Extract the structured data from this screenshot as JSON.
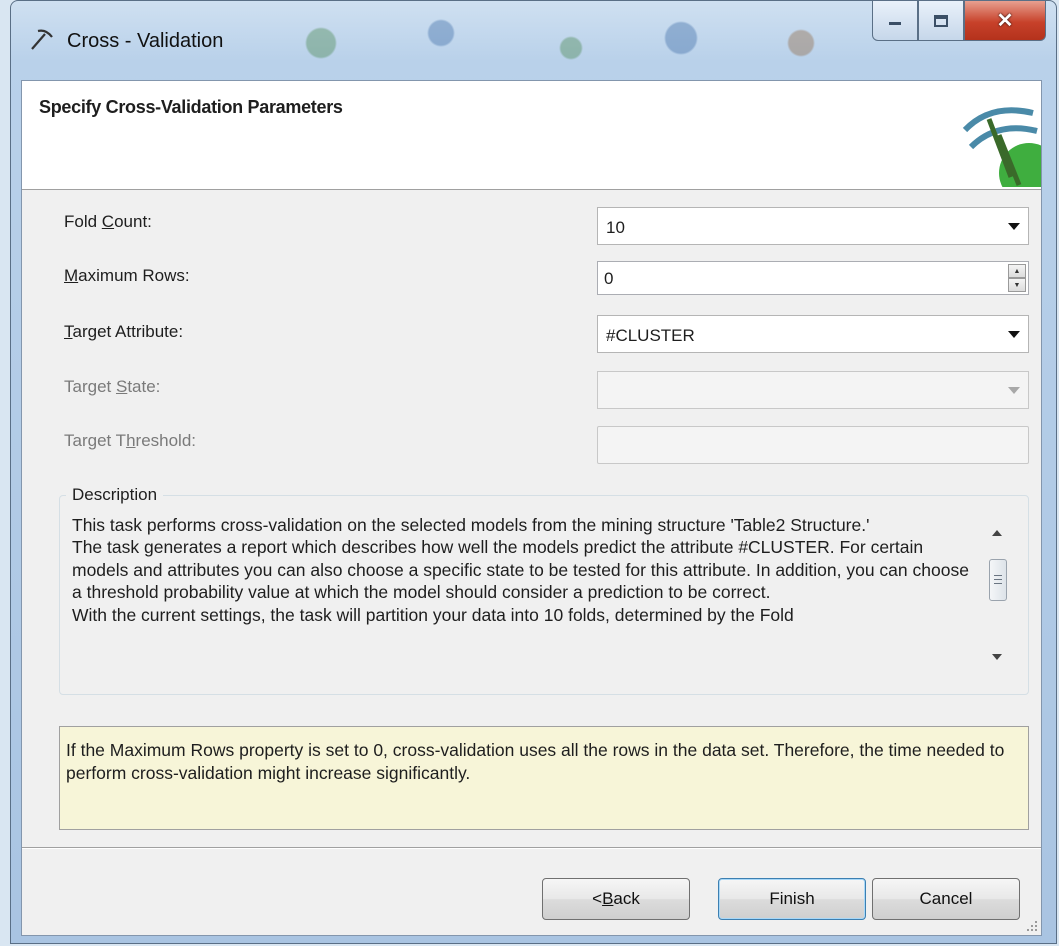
{
  "window": {
    "title": "Cross - Validation"
  },
  "header": {
    "title": "Specify Cross-Validation Parameters"
  },
  "fields": {
    "fold_count": {
      "label_pre": "Fold ",
      "label_access": "C",
      "label_post": "ount:",
      "value": "10"
    },
    "maximum_rows": {
      "label_access": "M",
      "label_post": "aximum Rows:",
      "value": "0"
    },
    "target_attribute": {
      "label_access": "T",
      "label_post": "arget Attribute:",
      "value": "#CLUSTER"
    },
    "target_state": {
      "label_pre": "Target ",
      "label_access": "S",
      "label_post": "tate:",
      "value": ""
    },
    "target_threshold": {
      "label_pre": "Target T",
      "label_access": "h",
      "label_post": "reshold:",
      "value": ""
    }
  },
  "description": {
    "legend": "Description",
    "paragraphs": [
      "This task performs cross-validation on the selected models from the mining structure 'Table2 Structure.'",
      "The task generates a report which describes how well the models predict the attribute #CLUSTER.  For certain models and attributes you can also choose a specific state to be tested for this attribute. In addition, you can choose a threshold probability value at which the model should consider a prediction to be correct.",
      "With the current settings, the task will partition your data into 10 folds, determined by the Fold"
    ]
  },
  "note": "If the Maximum Rows property is set to 0, cross-validation uses all the rows in the data set. Therefore, the time needed to perform cross-validation might increase significantly.",
  "buttons": {
    "back_pre": "< ",
    "back_access": "B",
    "back_post": "ack",
    "finish": "Finish",
    "cancel": "Cancel"
  },
  "colors": {
    "note_background": "#f7f5d8",
    "close_button": "#c7412a",
    "dialog_background": "#f0f0f0"
  }
}
